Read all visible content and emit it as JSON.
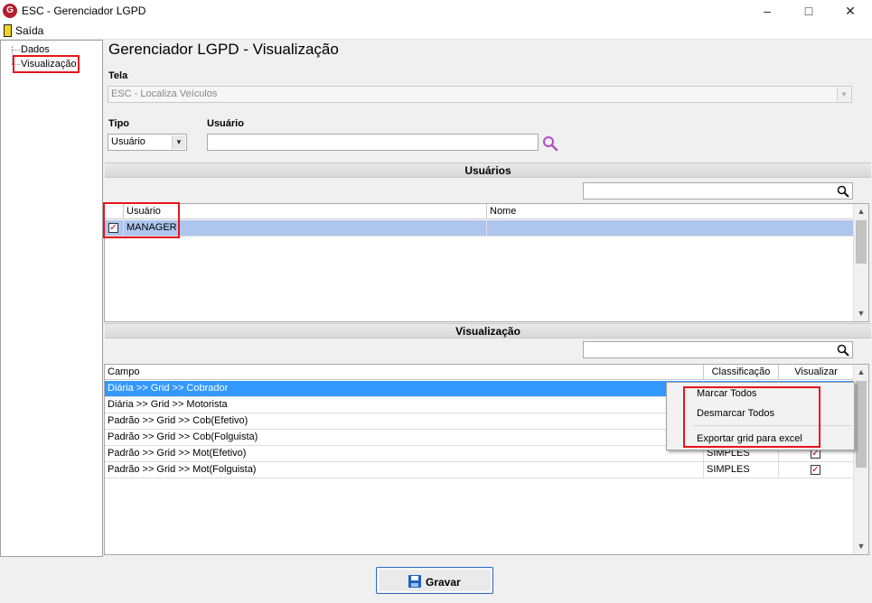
{
  "window": {
    "title": "ESC - Gerenciador LGPD",
    "app_icon": "G"
  },
  "menu": {
    "exit_label": "Saída"
  },
  "tree": {
    "items": [
      "Dados",
      "Visualização"
    ]
  },
  "page_title": "Gerenciador LGPD - Visualização",
  "tela": {
    "label": "Tela",
    "value": "ESC - Localiza Veículos"
  },
  "tipo": {
    "label": "Tipo",
    "value": "Usuário"
  },
  "usuario": {
    "label": "Usuário",
    "value": ""
  },
  "usuarios_section": {
    "title": "Usuários",
    "search_value": "",
    "columns": [
      "Usuário",
      "Nome"
    ],
    "rows": [
      {
        "checked": true,
        "usuario": "MANAGER",
        "nome": ""
      }
    ]
  },
  "visualizacao_section": {
    "title": "Visualização",
    "search_value": "",
    "columns": [
      "Campo",
      "Classificação",
      "Visualizar"
    ],
    "rows": [
      {
        "campo": "Diária >> Grid >> Cobrador",
        "classificacao": "",
        "visualizar": true
      },
      {
        "campo": "Diária >> Grid >> Motorista",
        "classificacao": "",
        "visualizar": true
      },
      {
        "campo": "Padrão >> Grid >> Cob(Efetivo)",
        "classificacao": "",
        "visualizar": true
      },
      {
        "campo": "Padrão >> Grid >> Cob(Folguista)",
        "classificacao": "",
        "visualizar": true
      },
      {
        "campo": "Padrão >> Grid >> Mot(Efetivo)",
        "classificacao": "SIMPLES",
        "visualizar": true
      },
      {
        "campo": "Padrão >> Grid >> Mot(Folguista)",
        "classificacao": "SIMPLES",
        "visualizar": true
      }
    ]
  },
  "context_menu": {
    "items": [
      "Marcar Todos",
      "Desmarcar Todos",
      "Exportar grid para excel"
    ]
  },
  "buttons": {
    "save_label": "Gravar"
  },
  "colors": {
    "highlight_red": "#e8141e",
    "selection_blue": "#3399ff",
    "selection_light": "#aec6ee",
    "check_red": "#c00010",
    "search_icon_purple": "#b04ec8"
  }
}
